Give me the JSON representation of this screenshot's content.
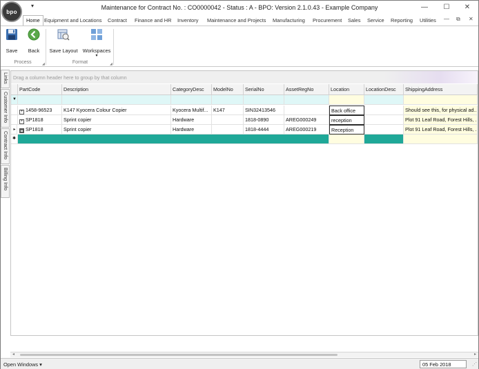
{
  "app": {
    "logo_text": "bpo",
    "title": "Maintenance for Contract No. : CO0000042 - Status : A - BPO: Version 2.1.0.43 - Example Company"
  },
  "window_controls": {
    "minimize": "—",
    "maximize": "☐",
    "close": "✕"
  },
  "quick_access": {
    "arrow": "▾"
  },
  "tabs": [
    {
      "label": "Home",
      "active": true
    },
    {
      "label": "Equipment and Locations"
    },
    {
      "label": "Contract"
    },
    {
      "label": "Finance and HR"
    },
    {
      "label": "Inventory"
    },
    {
      "label": "Maintenance and Projects"
    },
    {
      "label": "Manufacturing"
    },
    {
      "label": "Procurement"
    },
    {
      "label": "Sales"
    },
    {
      "label": "Service"
    },
    {
      "label": "Reporting"
    },
    {
      "label": "Utilities"
    }
  ],
  "tab_controls": {
    "collapse": "—",
    "restore": "⧉",
    "close": "✕"
  },
  "ribbon": {
    "process": {
      "label": "Process",
      "save": "Save",
      "back": "Back"
    },
    "format": {
      "label": "Format",
      "save_layout": "Save Layout",
      "workspaces": "Workspaces",
      "workspaces_arrow": "▾"
    }
  },
  "sidetabs": [
    "Links",
    "Customer Info",
    "Contract Info",
    "Billing Info"
  ],
  "grid": {
    "group_hint": "Drag a column header here to group by that column",
    "filter_icon": "▼",
    "columns": [
      "PartCode",
      "Description",
      "CategoryDesc",
      "ModelNo",
      "SerialNo",
      "AssetRegNo",
      "Location",
      "LocationDesc",
      "ShippingAddress"
    ],
    "rows": [
      {
        "cells": [
          "1458-96523",
          "K147 Kyocera Colour Copier",
          "Kyocera Multif...",
          "K147",
          "SIN32413546",
          "",
          "Back office",
          "",
          "Should see this, for physical ad..."
        ]
      },
      {
        "cells": [
          "SP1818",
          "Sprint copier",
          "Hardware",
          "",
          "1818-0890",
          "AREG000249",
          "reception",
          "",
          "Plot 91 Leaf Road, Forest Hills, ..."
        ]
      },
      {
        "cells": [
          "SP1818",
          "Sprint copier",
          "Hardware",
          "",
          "1818-4444",
          "AREG000219",
          "Reception",
          "",
          "Plot 91 Leaf Road, Forest Hills, ..."
        ]
      }
    ],
    "row_indicator": "▸",
    "new_row_indicator": "✱",
    "expand_symbol": "+"
  },
  "scrollbar": {
    "left": "◂",
    "right": "▸"
  },
  "statusbar": {
    "open_windows": "Open Windows ▾",
    "date": "05 Feb 2018",
    "grip": "⋰"
  },
  "colors": {
    "accent_new_row": "#1fa898",
    "filter_row": "#dff7f7",
    "yellow_col": "#fffde0"
  }
}
